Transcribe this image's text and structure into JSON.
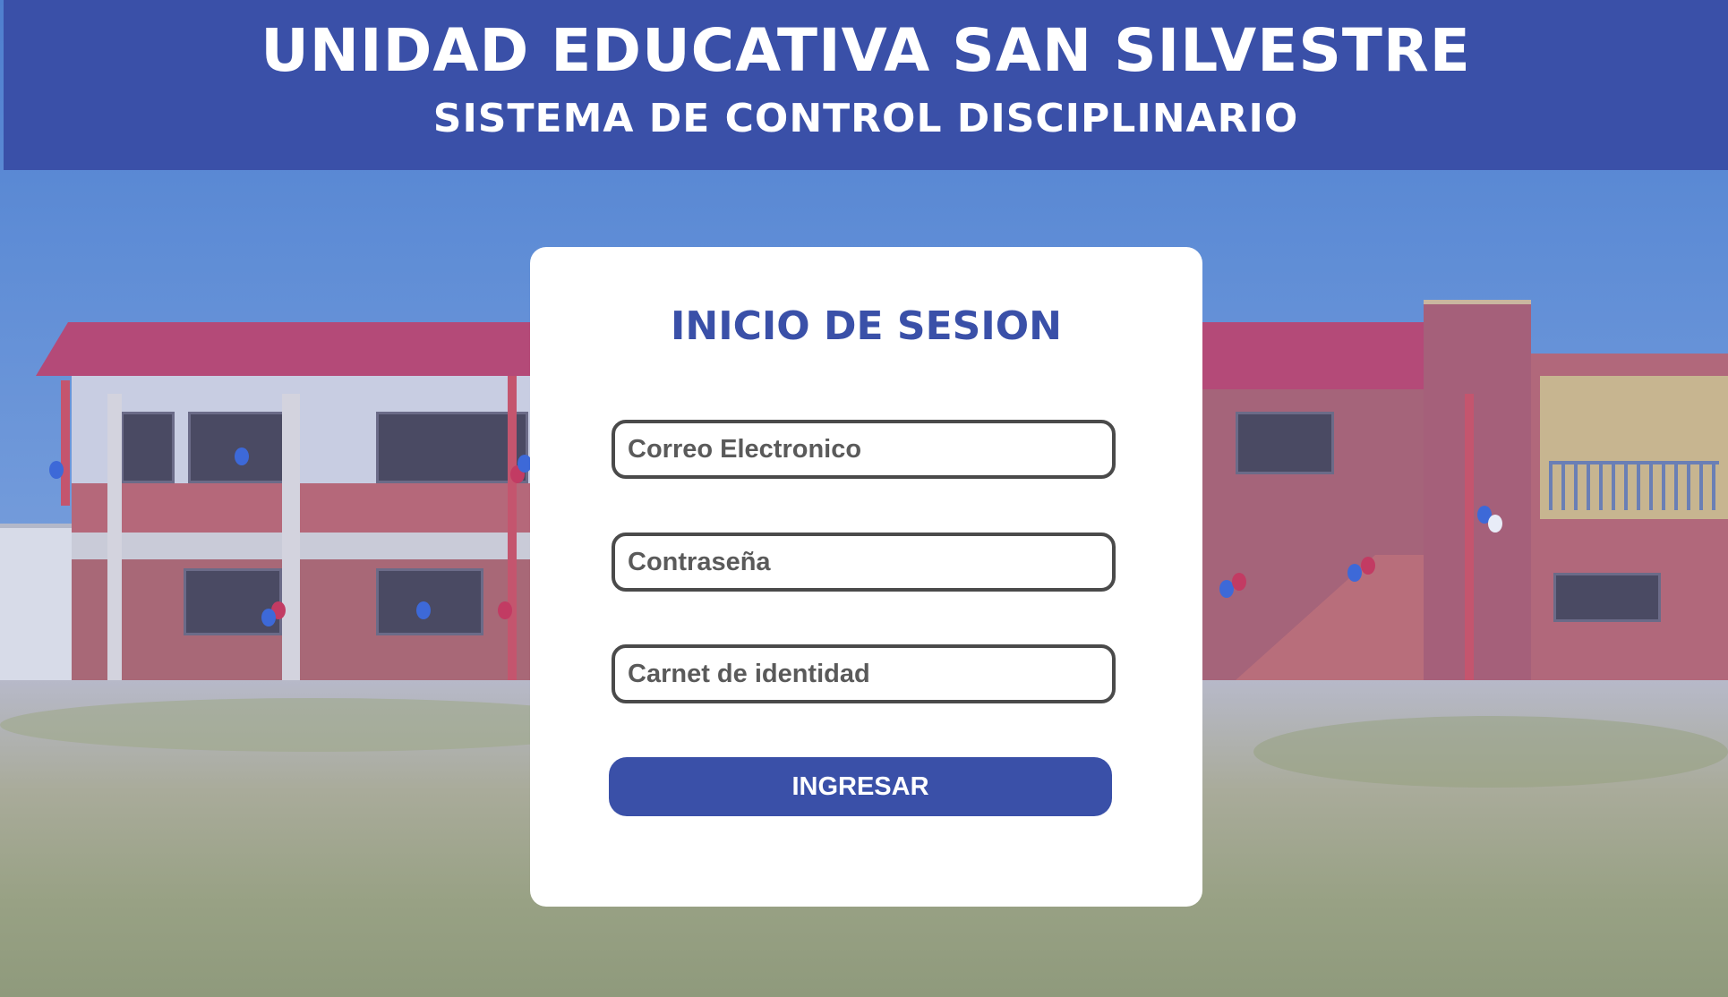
{
  "header": {
    "title": "UNIDAD EDUCATIVA SAN SILVESTRE",
    "subtitle": "SISTEMA DE CONTROL DISCIPLINARIO"
  },
  "login": {
    "title": "INICIO DE SESION",
    "email": {
      "value": "",
      "placeholder": "Correo Electronico"
    },
    "password": {
      "value": "",
      "placeholder": "Contraseña"
    },
    "id_card": {
      "value": "",
      "placeholder": "Carnet de identidad"
    },
    "submit_label": "INGRESAR"
  },
  "colors": {
    "brand": "#3a50a8",
    "card_background": "#ffffff",
    "field_border": "#4a4a4a"
  }
}
